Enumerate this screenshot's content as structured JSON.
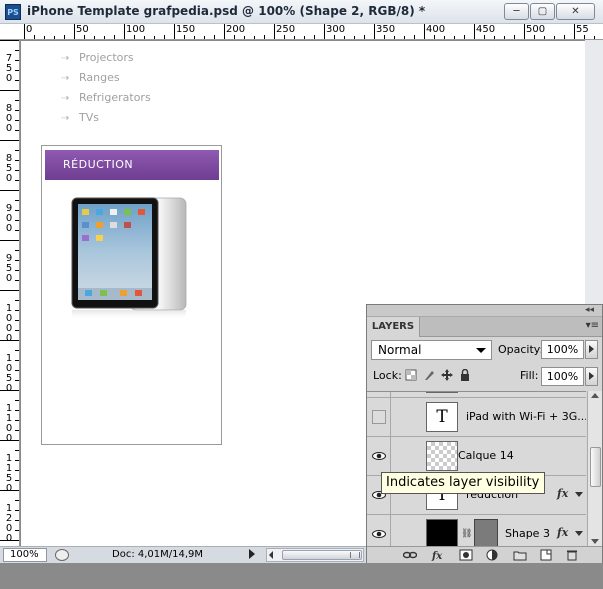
{
  "window": {
    "app_icon": "PS",
    "title": "iPhone Template grafpedia.psd @ 100% (Shape 2, RGB/8) *",
    "controls": {
      "minimize": "─",
      "maximize": "▢",
      "close": "✕"
    }
  },
  "ruler_top": {
    "labels": [
      "0",
      "50",
      "100",
      "150",
      "200",
      "250",
      "300",
      "350",
      "400",
      "450",
      "500",
      "55"
    ]
  },
  "ruler_left": {
    "labels": [
      "7\n5\n0",
      "8\n0\n0",
      "8\n5\n0",
      "9\n0\n0",
      "9\n5\n0",
      "1\n0\n0\n0",
      "1\n0\n5\n0",
      "1\n1\n0\n0",
      "1\n1\n5\n0",
      "1\n2\n0\n0"
    ]
  },
  "canvas": {
    "menu_items": [
      {
        "arrow": "⇢",
        "label": "Projectors"
      },
      {
        "arrow": "⇢",
        "label": "Ranges"
      },
      {
        "arrow": "⇢",
        "label": "Refrigerators"
      },
      {
        "arrow": "⇢",
        "label": "TVs"
      }
    ],
    "product": {
      "banner": "RÉDUCTION",
      "image": "ipad-product-image"
    }
  },
  "statusbar": {
    "zoom": "100%",
    "doc_info": "Doc: 4,01M/14,9M"
  },
  "layers_panel": {
    "tab_label": "LAYERS",
    "collapse_icon": "◂◂",
    "menu_icon": "▾≡",
    "blend_mode": "Normal",
    "opacity_label": "Opacity:",
    "opacity_value": "100%",
    "lock_label": "Lock:",
    "fill_label": "Fill:",
    "fill_value": "100%",
    "layers": [
      {
        "name": "iPad with Wi-Fi + 3G...",
        "thumb": "T",
        "visible": false,
        "type": "text"
      },
      {
        "name": "Calque 14",
        "thumb": "",
        "visible": true,
        "type": "raster"
      },
      {
        "name": "réduction",
        "thumb": "T",
        "visible": true,
        "type": "text",
        "fx": "fx"
      },
      {
        "name": "Shape 3",
        "thumb": "",
        "visible": true,
        "type": "shape",
        "fx": "fx"
      }
    ]
  },
  "tooltip": {
    "text": "Indicates layer visibility"
  }
}
